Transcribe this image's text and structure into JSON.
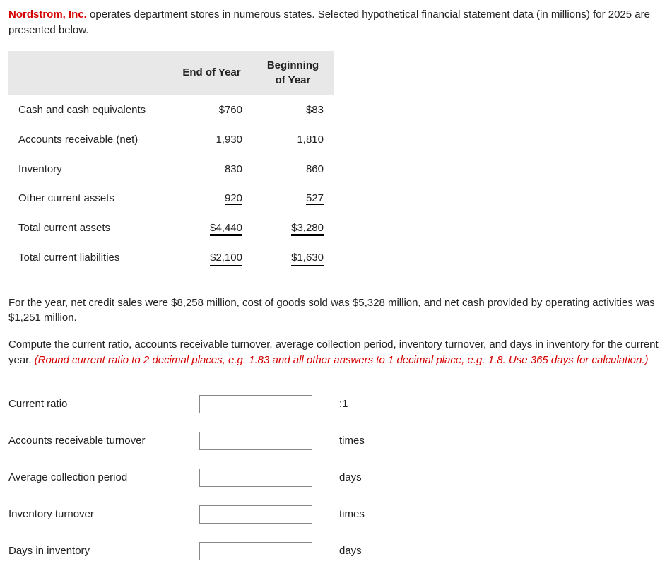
{
  "intro": {
    "company": "Nordstrom, Inc.",
    "rest": " operates department stores in numerous states. Selected hypothetical financial statement data (in millions) for 2025 are presented below."
  },
  "table": {
    "headers": {
      "col1": "End of Year",
      "col2": "Beginning of Year"
    },
    "rows": [
      {
        "label": "Cash and cash equivalents",
        "end": "$760",
        "beg": "$83"
      },
      {
        "label": "Accounts receivable (net)",
        "end": "1,930",
        "beg": "1,810"
      },
      {
        "label": "Inventory",
        "end": "830",
        "beg": "860"
      },
      {
        "label": "Other current assets",
        "end": "920",
        "beg": "527"
      },
      {
        "label": "Total current assets",
        "end": "$4,440",
        "beg": "$3,280"
      },
      {
        "label": "Total current liabilities",
        "end": "$2,100",
        "beg": "$1,630"
      }
    ]
  },
  "paragraph2": "For the year, net credit sales were $8,258 million, cost of goods sold was $5,328 million, and net cash provided by operating activities was $1,251 million.",
  "paragraph3": {
    "plain": "Compute the current ratio, accounts receivable turnover, average collection period, inventory turnover, and days in inventory for the current year. ",
    "red": "(Round current ratio to 2 decimal places, e.g. 1.83 and all other answers to 1 decimal place, e.g. 1.8. Use 365 days for calculation.)"
  },
  "answers": [
    {
      "label": "Current ratio",
      "unit": ":1"
    },
    {
      "label": "Accounts receivable turnover",
      "unit": "times"
    },
    {
      "label": "Average collection period",
      "unit": "days"
    },
    {
      "label": "Inventory turnover",
      "unit": "times"
    },
    {
      "label": "Days in inventory",
      "unit": "days"
    }
  ]
}
